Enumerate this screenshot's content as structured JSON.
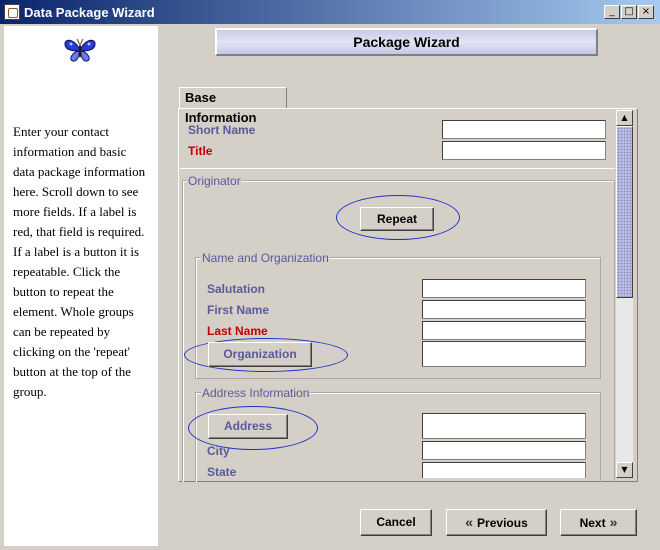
{
  "window": {
    "title": "Data Package Wizard",
    "min_glyph": "_",
    "max_glyph": "□",
    "close_glyph": "×"
  },
  "left_pane": {
    "icon": "butterfly-icon",
    "help_text": "Enter your contact information and basic data package information here. Scroll down to see more fields. If a label is red, that field is required. If a label is a button it is repeatable. Click the button to repeat the element. Whole groups can be repeated by clicking on the 'repeat' button at the top of the group."
  },
  "banner": {
    "title": "Package Wizard"
  },
  "tabs": [
    {
      "label": "Base Information",
      "selected": true
    }
  ],
  "form": {
    "short_name": {
      "label": "Short Name",
      "value": ""
    },
    "title": {
      "label": "Title",
      "value": "",
      "required": true
    },
    "originator": {
      "group_title": "Originator",
      "repeat_label": "Repeat",
      "name_org": {
        "group_title": "Name and Organization",
        "salutation": {
          "label": "Salutation",
          "value": ""
        },
        "first_name": {
          "label": "First Name",
          "value": ""
        },
        "last_name": {
          "label": "Last Name",
          "value": "",
          "required": true
        },
        "organization": {
          "label": "Organization",
          "value": ""
        }
      },
      "address": {
        "group_title": "Address Information",
        "address": {
          "label": "Address",
          "value": ""
        },
        "city": {
          "label": "City",
          "value": ""
        },
        "state": {
          "label": "State",
          "value": ""
        }
      }
    }
  },
  "scrollbar": {
    "up_glyph": "▲",
    "down_glyph": "▼"
  },
  "footer": {
    "cancel": "Cancel",
    "previous": "Previous",
    "next": "Next",
    "prev_glyph": "«",
    "next_glyph": "»"
  },
  "colors": {
    "title_bar": "#0a246a",
    "label": "#5a5a99",
    "required": "#c00000",
    "highlight": "#1e33c8"
  }
}
